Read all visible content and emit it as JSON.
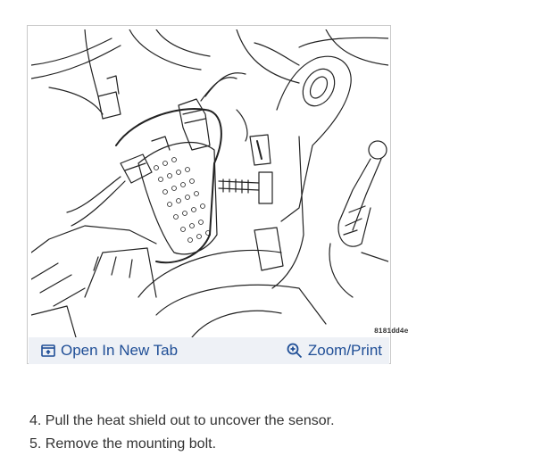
{
  "figure": {
    "code_label": "8181dd4e",
    "actions": {
      "open_new_tab": "Open In New Tab",
      "zoom_print": "Zoom/Print"
    }
  },
  "instructions": [
    "4. Pull the heat shield out to uncover the sensor.",
    "5. Remove the mounting bolt."
  ],
  "colors": {
    "link": "#1f4e96",
    "action_bar": "#eef1f6",
    "border": "#c9c9c9",
    "text": "#333333"
  }
}
